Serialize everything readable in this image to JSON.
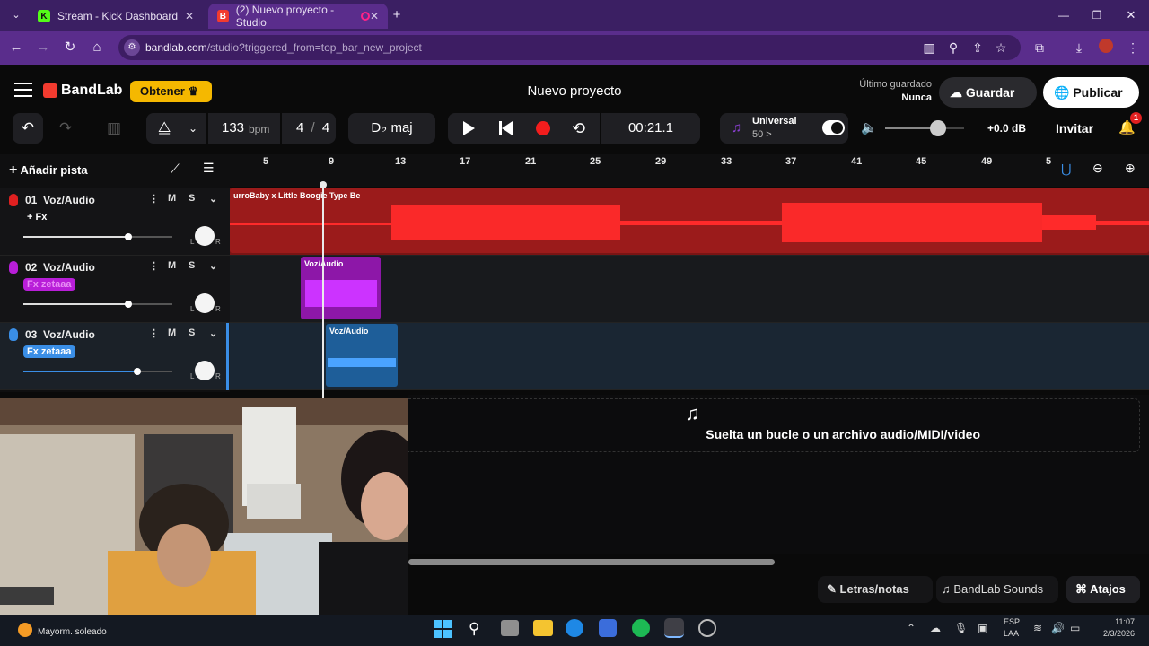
{
  "browser": {
    "tabs": [
      {
        "title": "Stream - Kick Dashboard",
        "favicon": "K",
        "active": false
      },
      {
        "title": "(2) Nuevo proyecto - Studio",
        "favicon": "B",
        "active": true
      }
    ],
    "url_host": "bandlab.com",
    "url_path": "/studio?triggered_from=top_bar_new_project",
    "colors": {
      "tabbar": "#3b1f63",
      "addressbar": "#5a2d8c"
    }
  },
  "header": {
    "brand": "BandLab",
    "obtain_label": "Obtener",
    "project_title": "Nuevo proyecto",
    "last_saved_label": "Último guardado",
    "last_saved_value": "Nunca",
    "save_label": "Guardar",
    "publish_label": "Publicar",
    "colors": {
      "brand_red": "#f23b2f",
      "obtain_yellow": "#f5b800"
    }
  },
  "toolbar": {
    "bpm_value": "133",
    "bpm_unit": "bpm",
    "time_sig_num": "4",
    "time_sig_sep": "/",
    "time_sig_den": "4",
    "key": "D♭ maj",
    "time": "00:21.1",
    "preset_name": "Universal",
    "preset_value": "50 >",
    "volume_db": "+0.0 dB",
    "volume_level_fraction": 0.67,
    "invite_label": "Invitar",
    "notifications_count": "1"
  },
  "ruler": {
    "add_track_label": "Añadir pista",
    "ticks": [
      "5",
      "9",
      "13",
      "17",
      "21",
      "25",
      "29",
      "33",
      "37",
      "41",
      "45",
      "49",
      "5"
    ]
  },
  "tracks": [
    {
      "number": "01",
      "name": "Voz/Audio",
      "fx": "+ Fx",
      "color": "#e02020",
      "m": "M",
      "s": "S",
      "pan_l": "L",
      "pan_r": "R",
      "volume_fraction": 0.7,
      "clip_label": "urroBaby x Little Boogie Type Be"
    },
    {
      "number": "02",
      "name": "Voz/Audio",
      "fx": "Fx zetaaa",
      "color": "#b81ed8",
      "m": "M",
      "s": "S",
      "pan_l": "L",
      "pan_r": "R",
      "volume_fraction": 0.7,
      "clip_label": "Voz/Audio"
    },
    {
      "number": "03",
      "name": "Voz/Audio",
      "fx": "Fx zetaaa",
      "color": "#3a8ee6",
      "m": "M",
      "s": "S",
      "pan_l": "L",
      "pan_r": "R",
      "volume_fraction": 0.75,
      "clip_label": "Voz/Audio"
    }
  ],
  "dropzone": {
    "text": "Suelta un bucle o un archivo audio/MIDI/video"
  },
  "footer": {
    "lyrics_label": "Letras/notas",
    "sounds_label": "BandLab Sounds",
    "shortcuts_label": "Atajos"
  },
  "taskbar": {
    "weather": "Mayorm. soleado",
    "lang_1": "ESP",
    "lang_2": "LAA",
    "time": "11:07",
    "date": "2/3/2026"
  }
}
